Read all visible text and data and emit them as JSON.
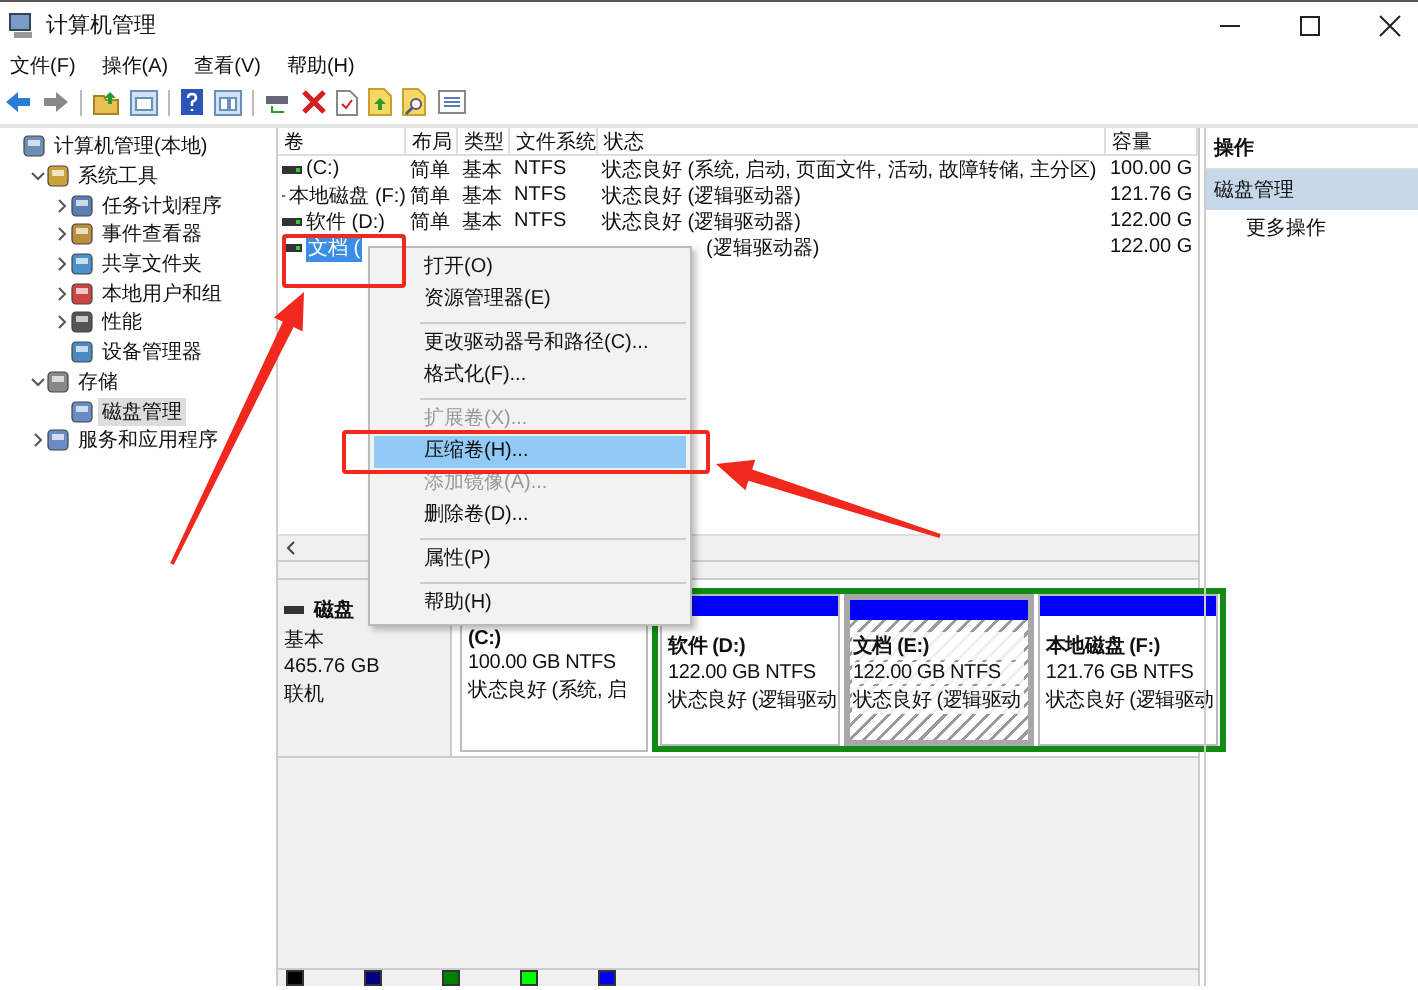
{
  "window": {
    "title": "计算机管理"
  },
  "menu": [
    "文件(F)",
    "操作(A)",
    "查看(V)",
    "帮助(H)"
  ],
  "tree": [
    {
      "label": "计算机管理(本地)",
      "selected": false,
      "children": [
        {
          "label": "系统工具",
          "expanded": true,
          "selected": false,
          "children": [
            {
              "label": "任务计划程序",
              "expanded": false,
              "selected": false
            },
            {
              "label": "事件查看器",
              "expanded": false,
              "selected": false
            },
            {
              "label": "共享文件夹",
              "expanded": false,
              "selected": false
            },
            {
              "label": "本地用户和组",
              "expanded": false,
              "selected": false
            },
            {
              "label": "性能",
              "expanded": false,
              "selected": false
            },
            {
              "label": "设备管理器",
              "selected": false
            }
          ]
        },
        {
          "label": "存储",
          "expanded": true,
          "selected": false,
          "children": [
            {
              "label": "磁盘管理",
              "selected": true
            }
          ]
        },
        {
          "label": "服务和应用程序",
          "expanded": false,
          "selected": false
        }
      ]
    }
  ],
  "table": {
    "columns": [
      "卷",
      "布局",
      "类型",
      "文件系统",
      "状态",
      "容量"
    ],
    "rows": [
      {
        "volume": "(C:)",
        "layout": "简单",
        "type": "基本",
        "fs": "NTFS",
        "status": "状态良好 (系统, 启动, 页面文件, 活动, 故障转储, 主分区)",
        "capacity": "100.00 G",
        "selected": false
      },
      {
        "volume": "本地磁盘 (F:)",
        "layout": "简单",
        "type": "基本",
        "fs": "NTFS",
        "status": "状态良好 (逻辑驱动器)",
        "capacity": "121.76 G",
        "selected": false
      },
      {
        "volume": "软件 (D:)",
        "layout": "简单",
        "type": "基本",
        "fs": "NTFS",
        "status": "状态良好 (逻辑驱动器)",
        "capacity": "122.00 G",
        "selected": false
      },
      {
        "volume": "文档 (",
        "status": "(逻辑驱动器)",
        "capacity": "122.00 G",
        "selected": true
      }
    ]
  },
  "context_menu": [
    {
      "kind": "item",
      "label": "打开(O)",
      "disabled": false,
      "selected": false
    },
    {
      "kind": "item",
      "label": "资源管理器(E)",
      "disabled": false,
      "selected": false
    },
    {
      "kind": "separator"
    },
    {
      "kind": "item",
      "label": "更改驱动器号和路径(C)...",
      "disabled": false,
      "selected": false
    },
    {
      "kind": "item",
      "label": "格式化(F)...",
      "disabled": false,
      "selected": false
    },
    {
      "kind": "separator"
    },
    {
      "kind": "item",
      "label": "扩展卷(X)...",
      "disabled": true,
      "selected": false
    },
    {
      "kind": "item",
      "label": "压缩卷(H)...",
      "disabled": false,
      "selected": true
    },
    {
      "kind": "item",
      "label": "添加镜像(A)...",
      "disabled": true,
      "selected": false
    },
    {
      "kind": "item",
      "label": "删除卷(D)...",
      "disabled": false,
      "selected": false
    },
    {
      "kind": "separator"
    },
    {
      "kind": "item",
      "label": "属性(P)",
      "disabled": false,
      "selected": false
    },
    {
      "kind": "separator"
    },
    {
      "kind": "item",
      "label": "帮助(H)",
      "disabled": false,
      "selected": false
    }
  ],
  "disk": {
    "name": "磁盘",
    "type": "基本",
    "size": "465.76 GB",
    "status": "联机",
    "partitions": [
      {
        "kind": "primary",
        "label": "(C:)",
        "size": "100.00 GB NTFS",
        "status": "状态良好 (系统, 启",
        "selected": false
      },
      {
        "kind": "logical",
        "label": "软件 (D:)",
        "size": "122.00 GB NTFS",
        "status": "状态良好 (逻辑驱动",
        "selected": false
      },
      {
        "kind": "logical",
        "label": "文档 (E:)",
        "size": "122.00 GB NTFS",
        "status": "状态良好 (逻辑驱动",
        "selected": true
      },
      {
        "kind": "logical",
        "label": "本地磁盘 (F:)",
        "size": "121.76 GB NTFS",
        "status": "状态良好 (逻辑驱动",
        "selected": false
      }
    ]
  },
  "legend": [
    {
      "color": "#000000"
    },
    {
      "color": "#000080"
    },
    {
      "color": "#008000"
    },
    {
      "color": "#00ff00"
    },
    {
      "color": "#0000ff"
    }
  ],
  "actions": {
    "header": "操作",
    "items": [
      {
        "label": "磁盘管理",
        "kind": "section",
        "selected": true
      },
      {
        "label": "更多操作",
        "kind": "item",
        "selected": false
      }
    ]
  },
  "annotations": [
    {
      "kind": "box"
    },
    {
      "kind": "box"
    },
    {
      "kind": "arrow"
    },
    {
      "kind": "arrow"
    }
  ]
}
